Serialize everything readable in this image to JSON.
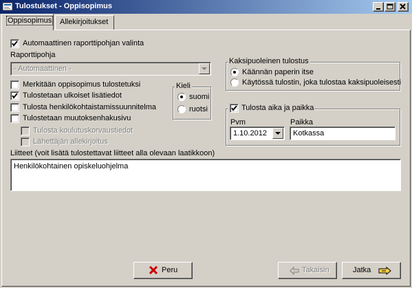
{
  "window": {
    "title": "Tulostukset - Oppisopimus"
  },
  "tabs": [
    {
      "label": "Oppisopimus"
    },
    {
      "label": "Allekirjoitukset"
    }
  ],
  "auto_template": {
    "label": "Automaattinen raporttipohjan valinta",
    "checked": true
  },
  "template": {
    "label": "Raporttipohja",
    "value": "- Automaattinen -"
  },
  "options": [
    {
      "label": "Merkitään oppisopimus tulostetuksi",
      "checked": false
    },
    {
      "label": "Tulostetaan ulkoiset lisätiedot",
      "checked": true
    },
    {
      "label": "Tulosta henkilökohtaistamissuunnitelma",
      "checked": false
    },
    {
      "label": "Tulostetaan muutoksenhakusivu",
      "checked": false
    }
  ],
  "disabled_options": [
    {
      "label": "Tulosta koulutuskorvaustiedot",
      "checked": false
    },
    {
      "label": "Lähettäjän allekirjoitus",
      "checked": false
    }
  ],
  "language": {
    "label": "Kieli",
    "options": [
      {
        "label": "suomi",
        "selected": true
      },
      {
        "label": "ruotsi",
        "selected": false
      }
    ]
  },
  "duplex": {
    "label": "Kaksipuoleinen tulostus",
    "options": [
      {
        "label": "Käännän paperin itse",
        "selected": true
      },
      {
        "label": "Käytössä tulostin, joka tulostaa kaksipuoleisesti",
        "selected": false
      }
    ]
  },
  "print_time_place": {
    "label": "Tulosta aika ja paikka",
    "checked": true,
    "date_label": "Pvm",
    "date_value": "1.10.2012",
    "place_label": "Paikka",
    "place_value": "Kotkassa"
  },
  "attachments": {
    "label": "Liitteet (voit lisätä tulostettavat liitteet alla olevaan laatikkoon)",
    "value": "Henkilökohtainen opiskeluohjelma"
  },
  "buttons": {
    "cancel": "Peru",
    "back": "Takaisin",
    "next": "Jatka"
  },
  "colors": {
    "titlebar_start": "#0a246a",
    "titlebar_end": "#a6caf0",
    "face": "#d4d0c8",
    "cancel_icon": "#cc0000"
  }
}
